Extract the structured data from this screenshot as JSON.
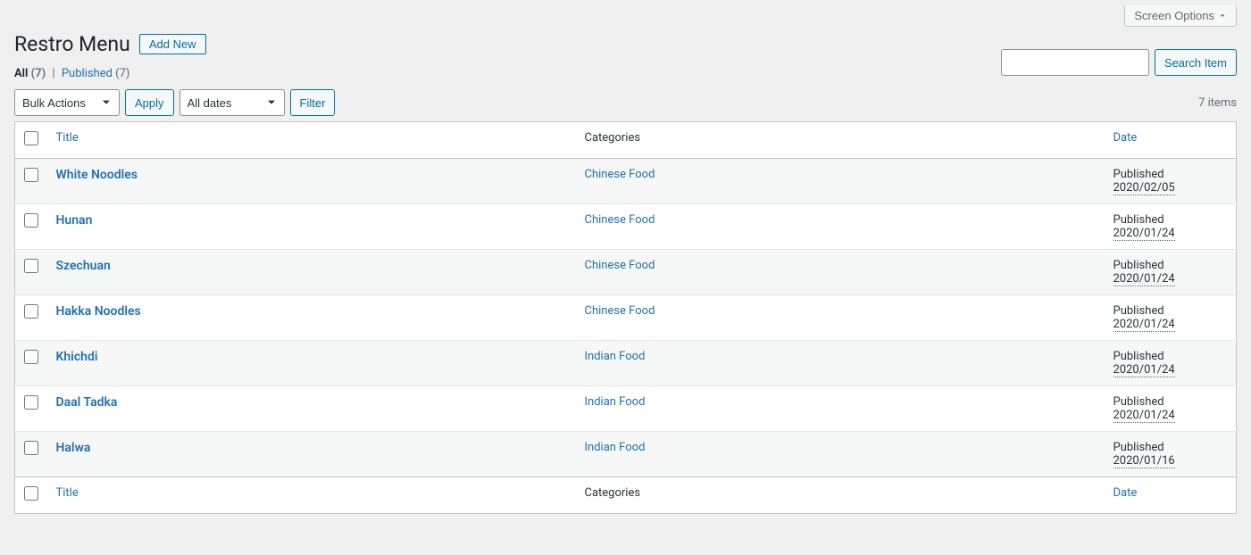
{
  "screen_options_label": "Screen Options",
  "page_title": "Restro Menu",
  "add_new_label": "Add New",
  "filters": {
    "all_label": "All",
    "all_count": "(7)",
    "separator": "|",
    "published_label": "Published",
    "published_count": "(7)"
  },
  "bulk_actions": {
    "selected": "Bulk Actions",
    "apply_label": "Apply"
  },
  "date_filter": {
    "selected": "All dates",
    "filter_label": "Filter"
  },
  "search": {
    "button_label": "Search Item"
  },
  "items_count_label": "7 items",
  "columns": {
    "title": "Title",
    "categories": "Categories",
    "date": "Date"
  },
  "rows": [
    {
      "title": "White Noodles",
      "category": "Chinese Food",
      "status": "Published",
      "date": "2020/02/05"
    },
    {
      "title": "Hunan",
      "category": "Chinese Food",
      "status": "Published",
      "date": "2020/01/24"
    },
    {
      "title": "Szechuan",
      "category": "Chinese Food",
      "status": "Published",
      "date": "2020/01/24"
    },
    {
      "title": "Hakka Noodles",
      "category": "Chinese Food",
      "status": "Published",
      "date": "2020/01/24"
    },
    {
      "title": "Khichdi",
      "category": "Indian Food",
      "status": "Published",
      "date": "2020/01/24"
    },
    {
      "title": "Daal Tadka",
      "category": "Indian Food",
      "status": "Published",
      "date": "2020/01/24"
    },
    {
      "title": "Halwa",
      "category": "Indian Food",
      "status": "Published",
      "date": "2020/01/16"
    }
  ]
}
